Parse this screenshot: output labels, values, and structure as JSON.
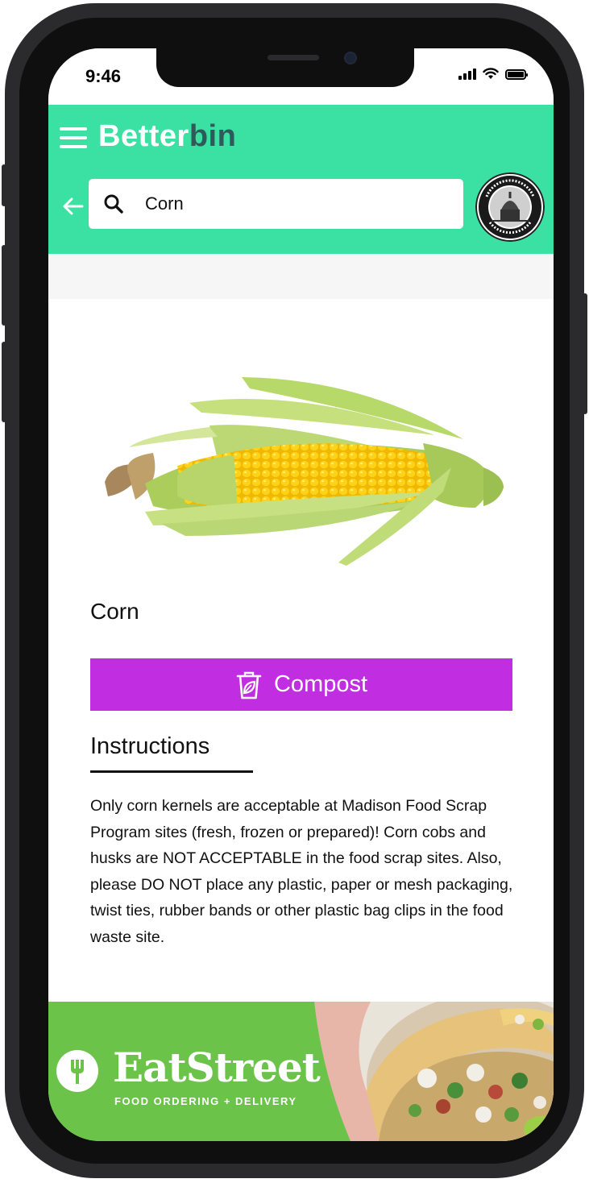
{
  "status_bar": {
    "time": "9:46"
  },
  "header": {
    "brand_part1": "Better",
    "brand_part2": "bin",
    "search": {
      "value": "Corn",
      "placeholder": ""
    },
    "city_logo_text": "CITY OF MADISON · WISCONSIN"
  },
  "item": {
    "title": "Corn",
    "image_icon": "corn-cob",
    "disposal": {
      "label": "Compost",
      "icon": "compost-bin-leaf-icon",
      "color": "#c12ee1"
    }
  },
  "instructions": {
    "title": "Instructions",
    "body": "Only corn kernels are acceptable at Madison Food Scrap Program sites (fresh, frozen or prepared)! Corn cobs and husks are NOT ACCEPTABLE in the food scrap sites. Also, please DO NOT place any plastic, paper or mesh packaging, twist ties, rubber bands or other plastic bag clips in the food waste site."
  },
  "ad": {
    "brand": "EatStreet",
    "tagline": "FOOD ORDERING + DELIVERY",
    "color": "#6bc34a"
  },
  "theme": {
    "header_color": "#3be0a3",
    "brand_dark": "#2e5a5a"
  }
}
